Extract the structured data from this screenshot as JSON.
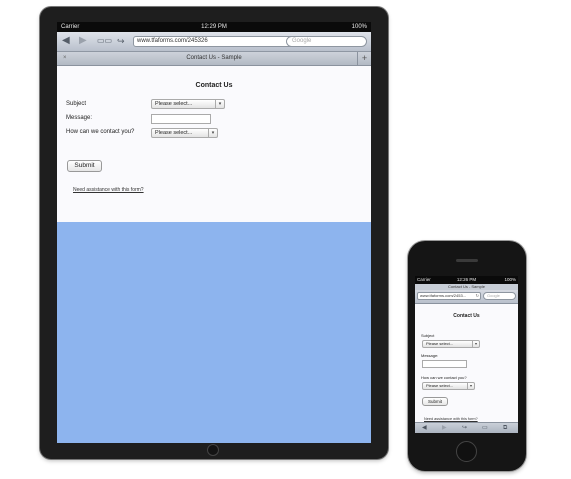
{
  "status": {
    "carrier": "Carrier",
    "time": "12:29 PM",
    "battery": "100%",
    "iphone_time": "12:26 PM"
  },
  "browser": {
    "url": "www.tfaforms.com/245326",
    "iphone_url": "www.tfaforms.com/2453...",
    "search_placeholder": "Google",
    "tab_title": "Contact Us - Sample",
    "tab_close": "×",
    "new_tab": "+",
    "reload_icon": "↻",
    "icons": [
      "back-icon",
      "forward-icon",
      "bookmarks-icon",
      "share-icon"
    ]
  },
  "form": {
    "title": "Contact Us",
    "subject_label": "Subject",
    "subject_value": "Please select...",
    "message_label": "Message:",
    "contact_label": "How can we contact you?",
    "contact_value": "Please select...",
    "submit_label": "Submit",
    "help_link": "Need assistance with this form?"
  },
  "colors": {
    "page_background": "#8db4ee",
    "device_body": "#1e1e1e"
  }
}
